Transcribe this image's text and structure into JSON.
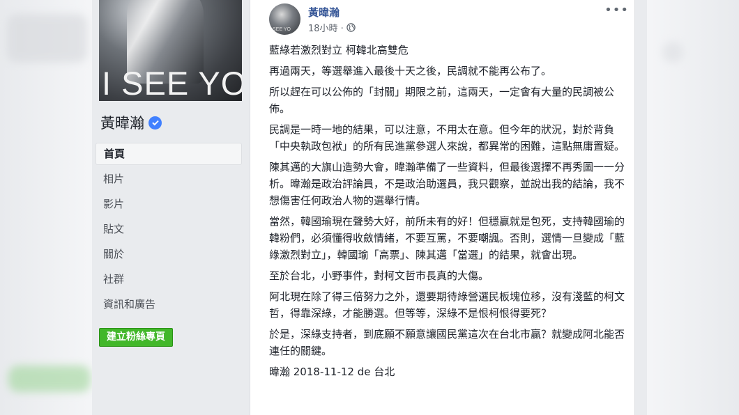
{
  "sidebar": {
    "cover_text": "I SEE YOU",
    "page_name": "黃暐瀚",
    "nav": [
      {
        "label": "首頁",
        "active": true
      },
      {
        "label": "相片",
        "active": false
      },
      {
        "label": "影片",
        "active": false
      },
      {
        "label": "貼文",
        "active": false
      },
      {
        "label": "關於",
        "active": false
      },
      {
        "label": "社群",
        "active": false
      },
      {
        "label": "資訊和廣告",
        "active": false
      }
    ],
    "create_button": "建立粉絲專頁"
  },
  "post": {
    "author": "黃暐瀚",
    "time": "18小時 ·",
    "more": "•••",
    "paragraphs": [
      "藍綠若激烈對立 柯韓北高雙危",
      "再過兩天，等選舉進入最後十天之後，民調就不能再公布了。",
      "所以趕在可以公佈的「封關」期限之前，這兩天，一定會有大量的民調被公佈。",
      "民調是一時一地的結果，可以注意，不用太在意。但今年的狀況，對於背負「中央執政包袱」的所有民進黨參選人來說，都異常的困難，這點無庸置疑。",
      "陳其邁的大旗山造勢大會，暐瀚準備了一些資料，但最後選擇不再秀圖一一分析。暐瀚是政治評論員，不是政治助選員，我只觀察，並說出我的結論，我不想傷害任何政治人物的選舉行情。",
      "當然，韓國瑜現在聲勢大好，前所未有的好！但穩贏就是包死，支持韓國瑜的韓粉們，必須懂得收斂情緒，不要互罵，不要嘲諷。否則，選情一旦變成「藍綠激烈對立」，韓國瑜「高票」、陳其邁「當選」的結果，就會出現。",
      "至於台北，小野事件，對柯文哲市長真的大傷。",
      "阿北現在除了得三倍努力之外，還要期待綠營選民板塊位移，沒有淺藍的柯文哲，得靠深綠，才能勝選。但等等，深綠不是恨柯恨得要死？",
      "於是，深綠支持者，到底願不願意讓國民黨這次在台北市贏？就變成阿北能否連任的關鍵。",
      "暐瀚 2018-11-12 de 台北"
    ]
  },
  "colors": {
    "link": "#385898",
    "verified": "#4080ff",
    "create_button": "#42b72a"
  }
}
